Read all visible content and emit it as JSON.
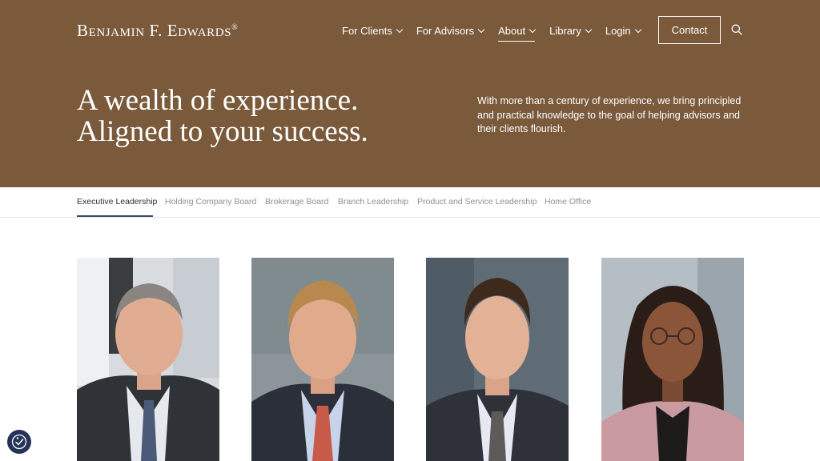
{
  "brand": {
    "logo_text": "Benjamin F. Edwards",
    "logo_mark": "®"
  },
  "nav": {
    "items": [
      {
        "label": "For Clients",
        "has_dropdown": true
      },
      {
        "label": "For Advisors",
        "has_dropdown": true
      },
      {
        "label": "About",
        "has_dropdown": true,
        "active": true
      },
      {
        "label": "Library",
        "has_dropdown": true
      },
      {
        "label": "Login",
        "has_dropdown": true
      }
    ],
    "contact_label": "Contact",
    "search_icon": "search-icon"
  },
  "hero": {
    "title_line1": "A wealth of experience.",
    "title_line2": "Aligned to your success.",
    "description": "With more than a century of experience, we bring principled and practical knowledge to the goal of helping advisors and their clients flourish."
  },
  "tabs": {
    "items": [
      {
        "label": "Executive Leadership",
        "active": true
      },
      {
        "label": "Holding Company Board"
      },
      {
        "label": "Brokerage Board"
      },
      {
        "label": "Branch Leadership"
      },
      {
        "label": "Product and Service Leadership"
      },
      {
        "label": "Home Office"
      }
    ]
  },
  "colors": {
    "brand_brown": "#7a5a3b",
    "tab_active": "#3a4b63",
    "accessibility_badge": "#243357"
  },
  "accessibility_badge_icon": "accessibility-check-icon"
}
